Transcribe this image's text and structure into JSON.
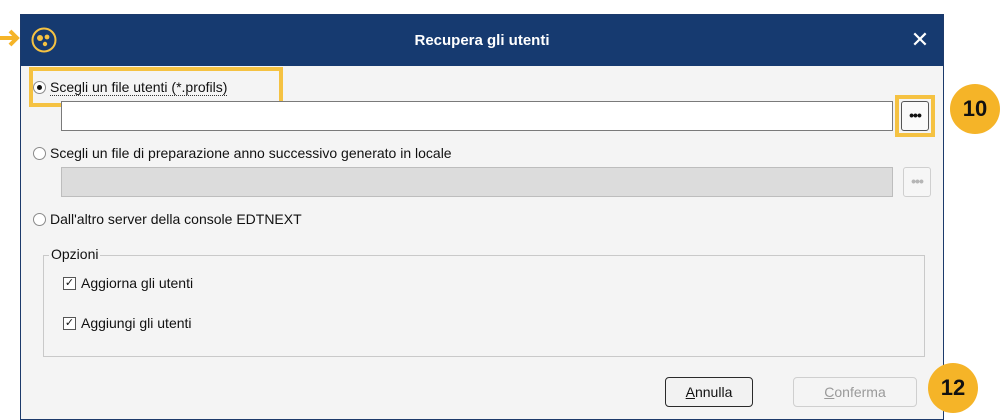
{
  "window": {
    "title": "Recupera gli utenti",
    "close_glyph": "✕"
  },
  "options": {
    "radio_profils": {
      "label": "Scegli un file utenti (*.profils)",
      "selected": true,
      "field_value": "",
      "browse_glyph": "•••"
    },
    "radio_local": {
      "label": "Scegli un file di preparazione anno successivo generato in locale",
      "selected": false,
      "field_value": "",
      "browse_glyph": "•••"
    },
    "radio_server": {
      "label": "Dall'altro server della console EDTNEXT",
      "selected": false
    }
  },
  "group": {
    "title": "Opzioni",
    "checkboxes": [
      {
        "label": "Aggiorna gli utenti",
        "checked": true
      },
      {
        "label": "Aggiungi gli utenti",
        "checked": true
      }
    ]
  },
  "buttons": {
    "cancel": {
      "label_first": "A",
      "label_rest": "nnulla"
    },
    "confirm": {
      "label_first": "C",
      "label_rest": "onferma",
      "enabled": false
    }
  },
  "badges": {
    "browse": "10",
    "confirm": "12"
  },
  "colors": {
    "titlebar": "#163a70",
    "highlight": "#f5c242",
    "badge": "#f5b428"
  }
}
